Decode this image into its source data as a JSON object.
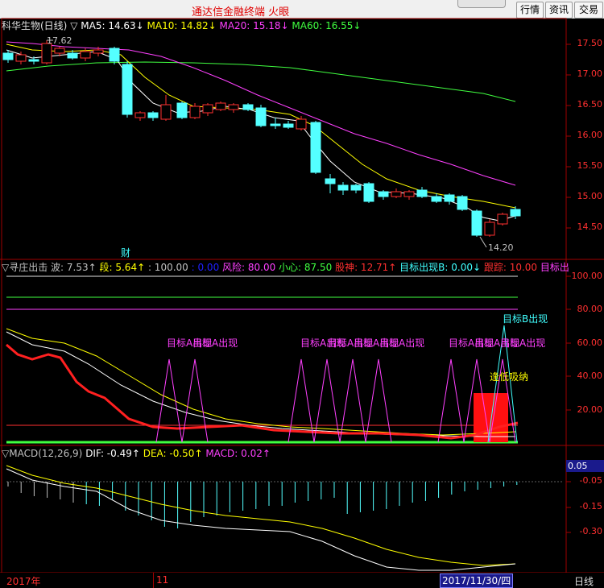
{
  "title_bar": {
    "app_title": "通达信金融终端 火眼",
    "buttons": [
      "行情",
      "资讯",
      "交易"
    ]
  },
  "price_panel": {
    "stock_label": "科华生物(日线)",
    "marker": "▽",
    "indicators": [
      {
        "text": "MA5: 14.63↓",
        "color": "#ffffff"
      },
      {
        "text": "MA10: 14.82↓",
        "color": "#ffff00"
      },
      {
        "text": "MA20: 15.18↓",
        "color": "#ff40ff"
      },
      {
        "text": "MA60: 16.55↓",
        "color": "#40ff40"
      }
    ],
    "high_label": "17.62",
    "low_label": "14.20",
    "event_label": "财",
    "y_ticks": [
      "17.50",
      "17.00",
      "16.50",
      "16.00",
      "15.50",
      "15.00",
      "14.50"
    ]
  },
  "middle_panel": {
    "segments": [
      {
        "text": "▽寻庄出击 波: 7.53↑",
        "color": "#c0c0c0"
      },
      {
        "text": "段: 5.64↑",
        "color": "#ffff00"
      },
      {
        "text": ": 100.00",
        "color": "#c0c0c0"
      },
      {
        "text": ": 0.00",
        "color": "#2020ff"
      },
      {
        "text": "风险: 80.00",
        "color": "#ff40ff"
      },
      {
        "text": "小心: 87.50",
        "color": "#40ff40"
      },
      {
        "text": "股神: 12.71↑",
        "color": "#ff3030"
      },
      {
        "text": "目标出现B: 0.00↓",
        "color": "#40ffff"
      },
      {
        "text": "跟踪: 10.00",
        "color": "#ff3030"
      },
      {
        "text": "目标出",
        "color": "#ff40ff"
      }
    ],
    "y_ticks": [
      "100.00",
      "80.00",
      "60.00",
      "40.00",
      "20.00"
    ],
    "annotations": [
      {
        "text": "目标A出现",
        "color": "#ff40ff"
      },
      {
        "text": "目标A出现",
        "color": "#ff40ff"
      },
      {
        "text": "目标A出现",
        "color": "#ff40ff"
      },
      {
        "text": "目标A出现",
        "color": "#ff40ff"
      },
      {
        "text": "目标A出现",
        "color": "#ff40ff"
      },
      {
        "text": "目标A出现",
        "color": "#ff40ff"
      },
      {
        "text": "目标A出现",
        "color": "#ff40ff"
      },
      {
        "text": "目标A出现",
        "color": "#ff40ff"
      },
      {
        "text": "目标A出现",
        "color": "#ff40ff"
      },
      {
        "text": "目标B出现",
        "color": "#40ffff"
      },
      {
        "text": "逢低吸纳",
        "color": "#ffff00"
      }
    ]
  },
  "macd_panel": {
    "segments": [
      {
        "text": "▽MACD(12,26,9)",
        "color": "#c0c0c0"
      },
      {
        "text": "DIF: -0.49↑",
        "color": "#ffffff"
      },
      {
        "text": "DEA: -0.50↑",
        "color": "#ffff00"
      },
      {
        "text": "MACD: 0.02↑",
        "color": "#ff40ff"
      }
    ],
    "current_value": "0.05",
    "y_ticks": [
      "-0.05",
      "-0.15",
      "-0.30"
    ]
  },
  "date_bar": {
    "year": "2017年",
    "month": "11",
    "cursor_date": "2017/11/30/四",
    "period": "日线"
  }
}
